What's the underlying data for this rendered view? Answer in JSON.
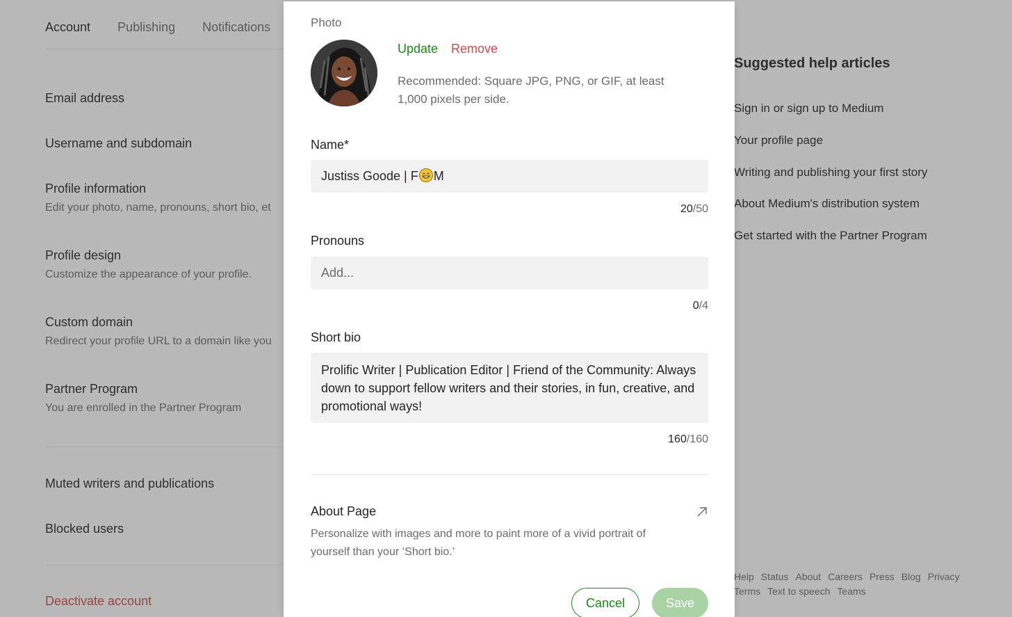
{
  "tabs": [
    {
      "label": "Account"
    },
    {
      "label": "Publishing"
    },
    {
      "label": "Notifications"
    }
  ],
  "settings": {
    "email": {
      "title": "Email address"
    },
    "username": {
      "title": "Username and subdomain"
    },
    "profile_info": {
      "title": "Profile information",
      "desc": "Edit your photo, name, pronouns, short bio, et"
    },
    "profile_design": {
      "title": "Profile design",
      "desc": "Customize the appearance of your profile."
    },
    "custom_domain": {
      "title": "Custom domain",
      "desc": "Redirect your profile URL to a domain like you"
    },
    "partner": {
      "title": "Partner Program",
      "desc": "You are enrolled in the Partner Program"
    },
    "muted": {
      "title": "Muted writers and publications"
    },
    "blocked": {
      "title": "Blocked users"
    },
    "deactivate": {
      "title": "Deactivate account"
    }
  },
  "help": {
    "title": "Suggested help articles",
    "links": [
      "Sign in or sign up to Medium",
      "Your profile page",
      "Writing and publishing your first story",
      "About Medium's distribution system",
      "Get started with the Partner Program"
    ]
  },
  "footer": [
    "Help",
    "Status",
    "About",
    "Careers",
    "Press",
    "Blog",
    "Privacy",
    "Terms",
    "Text to speech",
    "Teams"
  ],
  "modal": {
    "photo_label": "Photo",
    "update_label": "Update",
    "remove_label": "Remove",
    "photo_hint": "Recommended: Square JPG, PNG, or GIF, at least 1,000 pixels per side.",
    "name_label": "Name*",
    "name_value_prefix": "Justiss Goode | F",
    "name_value_suffix": "M",
    "name_count": "20",
    "name_max": "/50",
    "pronouns_label": "Pronouns",
    "pronouns_placeholder": "Add...",
    "pronouns_count": "0",
    "pronouns_max": "/4",
    "bio_label": "Short bio",
    "bio_value": "Prolific Writer | Publication Editor | Friend of the Community: Always down to support fellow writers and their stories, in fun, creative, and promotional ways!",
    "bio_count": "160",
    "bio_max": "/160",
    "about_title": "About Page",
    "about_desc": "Personalize with images and more to paint more of a vivid portrait of yourself than your ‘Short bio.’",
    "cancel_label": "Cancel",
    "save_label": "Save"
  }
}
